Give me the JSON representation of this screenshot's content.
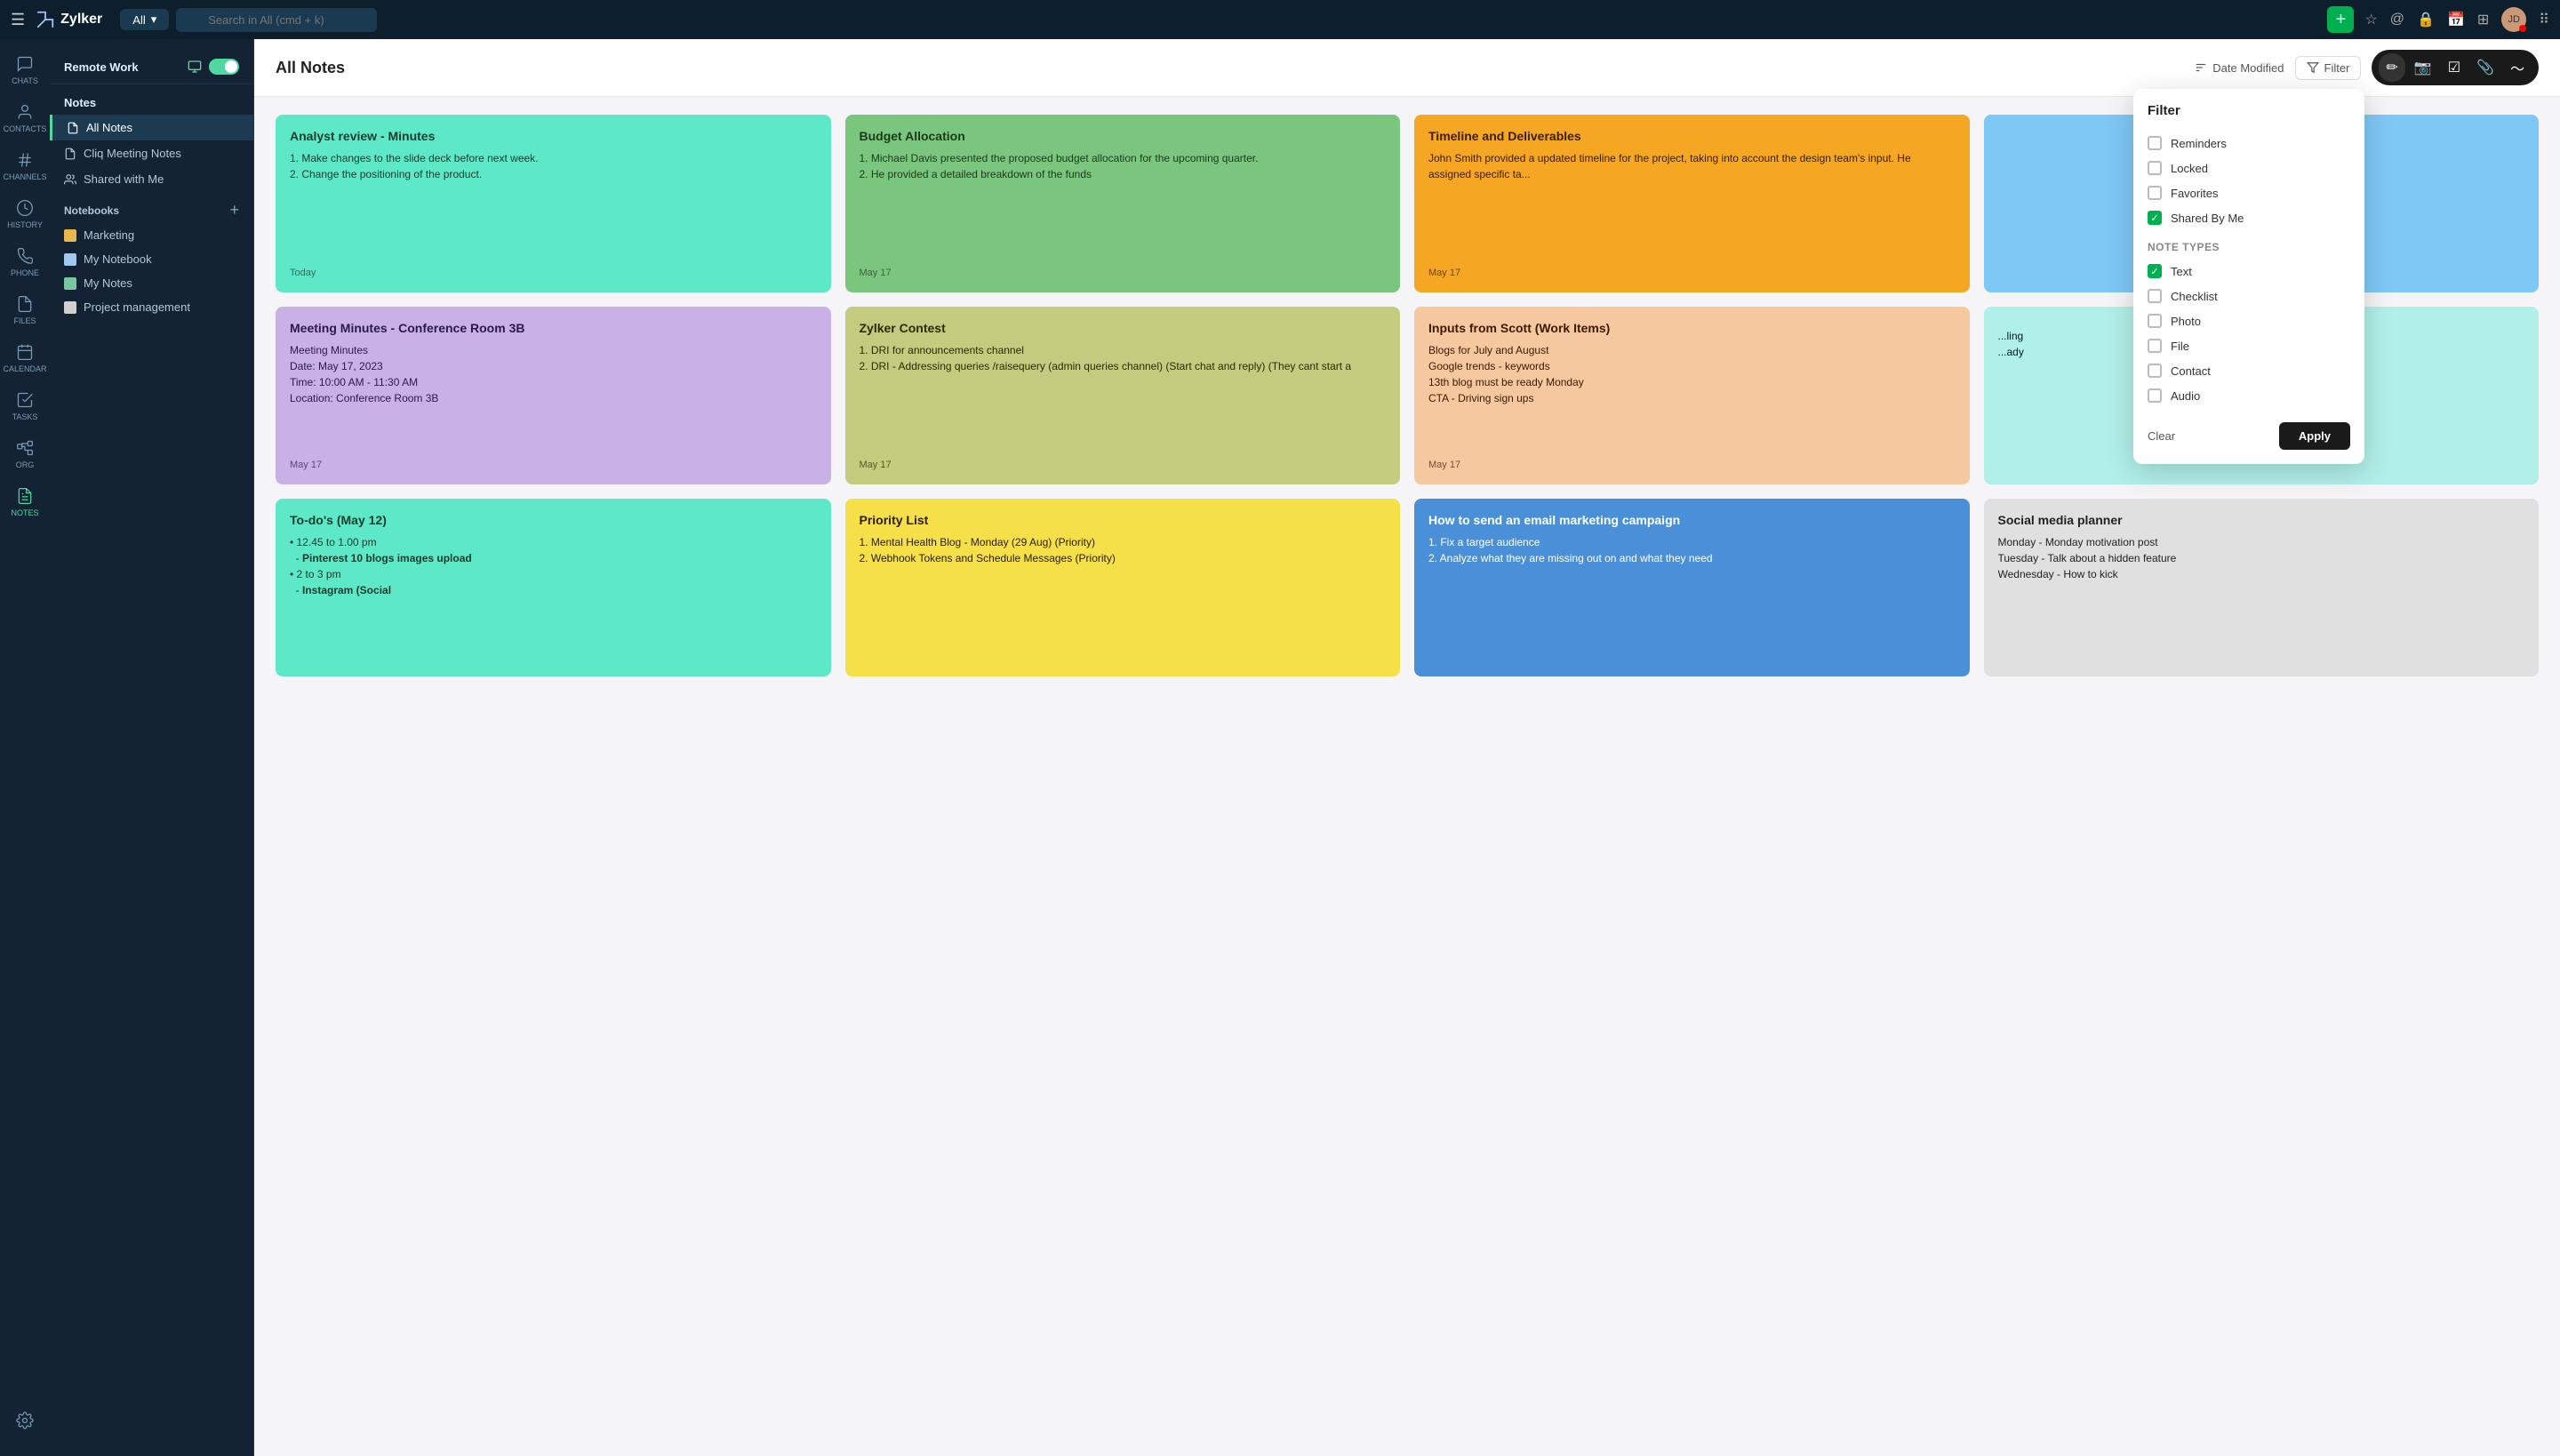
{
  "app": {
    "name": "Zylker",
    "workspace": "Remote Work"
  },
  "topbar": {
    "search_placeholder": "Search in All (cmd + k)",
    "all_label": "All",
    "add_label": "+"
  },
  "topbar_icons": [
    "star",
    "at",
    "lock",
    "calendar",
    "grid",
    "apps"
  ],
  "sidebar_icons": [
    {
      "id": "chats",
      "label": "CHATS",
      "active": false
    },
    {
      "id": "contacts",
      "label": "CONTACTS",
      "active": false
    },
    {
      "id": "channels",
      "label": "CHANNELS",
      "active": false
    },
    {
      "id": "history",
      "label": "HISTORY",
      "active": false
    },
    {
      "id": "phone",
      "label": "PHONE",
      "active": false
    },
    {
      "id": "files",
      "label": "FILES",
      "active": false
    },
    {
      "id": "calendar",
      "label": "CALENDAR",
      "active": false
    },
    {
      "id": "tasks",
      "label": "TASKS",
      "active": false
    },
    {
      "id": "org",
      "label": "ORG",
      "active": false
    },
    {
      "id": "notes",
      "label": "NOTES",
      "active": true
    }
  ],
  "nav": {
    "notes_title": "Notes",
    "items": [
      {
        "id": "all-notes",
        "label": "All Notes",
        "active": true,
        "icon": "note"
      },
      {
        "id": "cliq-meeting",
        "label": "Cliq Meeting Notes",
        "active": false,
        "icon": "note"
      },
      {
        "id": "shared-with-me",
        "label": "Shared with Me",
        "active": false,
        "icon": "people"
      }
    ],
    "notebooks_title": "Notebooks",
    "notebooks": [
      {
        "id": "marketing",
        "label": "Marketing",
        "color": "#e8b84b"
      },
      {
        "id": "my-notebook",
        "label": "My Notebook",
        "color": "#a0c8f0"
      },
      {
        "id": "my-notes",
        "label": "My Notes",
        "color": "#7ac8a0"
      },
      {
        "id": "project-management",
        "label": "Project management",
        "color": "#d0d0d0"
      }
    ]
  },
  "content": {
    "title": "All Notes",
    "sort_label": "Date Modified",
    "filter_label": "Filter"
  },
  "toolbar": {
    "edit_icon": "✏",
    "camera_icon": "📷",
    "check_icon": "☑",
    "attach_icon": "📎",
    "more_icon": "⋮"
  },
  "notes": [
    {
      "id": 1,
      "color": "note-teal",
      "title": "Analyst review - Minutes",
      "body": "1. Make changes to the slide deck before next week.\n2. Change the positioning of the product.",
      "date": "Today"
    },
    {
      "id": 2,
      "color": "note-green",
      "title": "Budget Allocation",
      "body": "1. Michael Davis presented the proposed budget allocation for the upcoming quarter.\n2. He provided a detailed breakdown of the funds",
      "date": "May 17"
    },
    {
      "id": 3,
      "color": "note-orange",
      "title": "Timeline and Deliverables",
      "body": "John Smith provided a updated timeline for the project, taking into account the design team's input. He assigned specific ta...",
      "date": "May 17"
    },
    {
      "id": 4,
      "color": "note-light-blue",
      "title": "...",
      "body": "...",
      "date": ""
    },
    {
      "id": 5,
      "color": "note-purple",
      "title": "Meeting Minutes - Conference Room 3B",
      "body": "Meeting Minutes\nDate: May 17, 2023\nTime: 10:00 AM - 11:30 AM\nLocation: Conference Room 3B",
      "date": "May 17"
    },
    {
      "id": 6,
      "color": "note-yellow-green",
      "title": "Zylker Contest",
      "body": "1. DRI for announcements channel\n2. DRI - Addressing queries /raisequery (admin queries channel) (Start chat and reply) (They cant start a",
      "date": "May 17"
    },
    {
      "id": 7,
      "color": "note-peach",
      "title": "Inputs from Scott (Work Items)",
      "body": "Blogs for July and August\nGoogle trends - keywords\n13th blog must be ready Monday\nCTA - Driving sign ups",
      "date": "May 17"
    },
    {
      "id": 8,
      "color": "note-light-cyan",
      "title": "...",
      "body": "...ling ...ady",
      "date": ""
    },
    {
      "id": 9,
      "color": "note-teal",
      "title": "To-do's (May 12)",
      "body": "• 12.45 to 1.00 pm\n  - Pinterest 10 blogs images upload\n• 2 to 3 pm\n  - Instagram (Social",
      "date": ""
    },
    {
      "id": 10,
      "color": "note-yellow",
      "title": "Priority List",
      "body": "1. Mental Health Blog - Monday (29 Aug) (Priority)\n2. Webhook Tokens and Schedule Messages (Priority)",
      "date": ""
    },
    {
      "id": 11,
      "color": "note-blue",
      "title": "How to send an email marketing campaign",
      "body": "1. Fix a target audience\n2. Analyze what they are missing out on and what they need",
      "date": ""
    },
    {
      "id": 12,
      "color": "note-gray",
      "title": "Social media planner",
      "body": "Monday - Monday motivation post\nTuesday - Talk about a hidden feature\nWednesday - How to kick",
      "date": ""
    }
  ],
  "filter": {
    "title": "Filter",
    "options": [
      {
        "id": "reminders",
        "label": "Reminders",
        "checked": false
      },
      {
        "id": "locked",
        "label": "Locked",
        "checked": false
      },
      {
        "id": "favorites",
        "label": "Favorites",
        "checked": false
      },
      {
        "id": "shared-by-me",
        "label": "Shared By Me",
        "checked": true
      }
    ],
    "note_types_title": "Note Types",
    "note_types": [
      {
        "id": "text",
        "label": "Text",
        "checked": true
      },
      {
        "id": "checklist",
        "label": "Checklist",
        "checked": false
      },
      {
        "id": "photo",
        "label": "Photo",
        "checked": false
      },
      {
        "id": "file",
        "label": "File",
        "checked": false
      },
      {
        "id": "contact",
        "label": "Contact",
        "checked": false
      },
      {
        "id": "audio",
        "label": "Audio",
        "checked": false
      }
    ],
    "clear_label": "Clear",
    "apply_label": "Apply"
  }
}
